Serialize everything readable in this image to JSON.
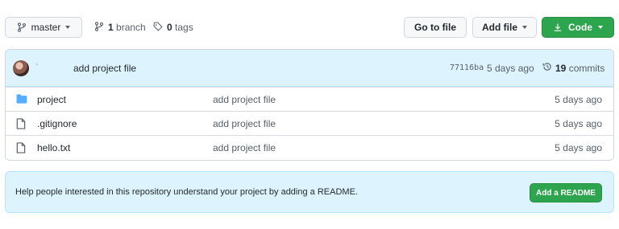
{
  "toolbar": {
    "branch_label": "master",
    "branch_count": "1",
    "branch_word": "branch",
    "tag_count": "0",
    "tag_word": "tags",
    "goto_label": "Go to file",
    "add_file_label": "Add file",
    "code_label": "Code"
  },
  "commit": {
    "author": "'",
    "message": "add project file",
    "sha": "77116ba",
    "time": "5 days ago",
    "count": "19",
    "count_word": "commits"
  },
  "files": [
    {
      "type": "folder",
      "name": "project",
      "message": "add project file",
      "age": "5 days ago"
    },
    {
      "type": "file",
      "name": ".gitignore",
      "message": "add project file",
      "age": "5 days ago"
    },
    {
      "type": "file",
      "name": "hello.txt",
      "message": "add project file",
      "age": "5 days ago"
    }
  ],
  "readme": {
    "text": "Help people interested in this repository understand your project by adding a README.",
    "button_label": "Add a README"
  },
  "colors": {
    "primary_green": "#2da44e",
    "info_blue_bg": "#ddf4ff",
    "folder_blue": "#54aeff"
  },
  "icons": {
    "branch": "git-branch-icon",
    "tag": "tag-icon",
    "download": "download-icon",
    "history": "history-icon",
    "folder": "folder-icon",
    "file": "file-icon"
  }
}
